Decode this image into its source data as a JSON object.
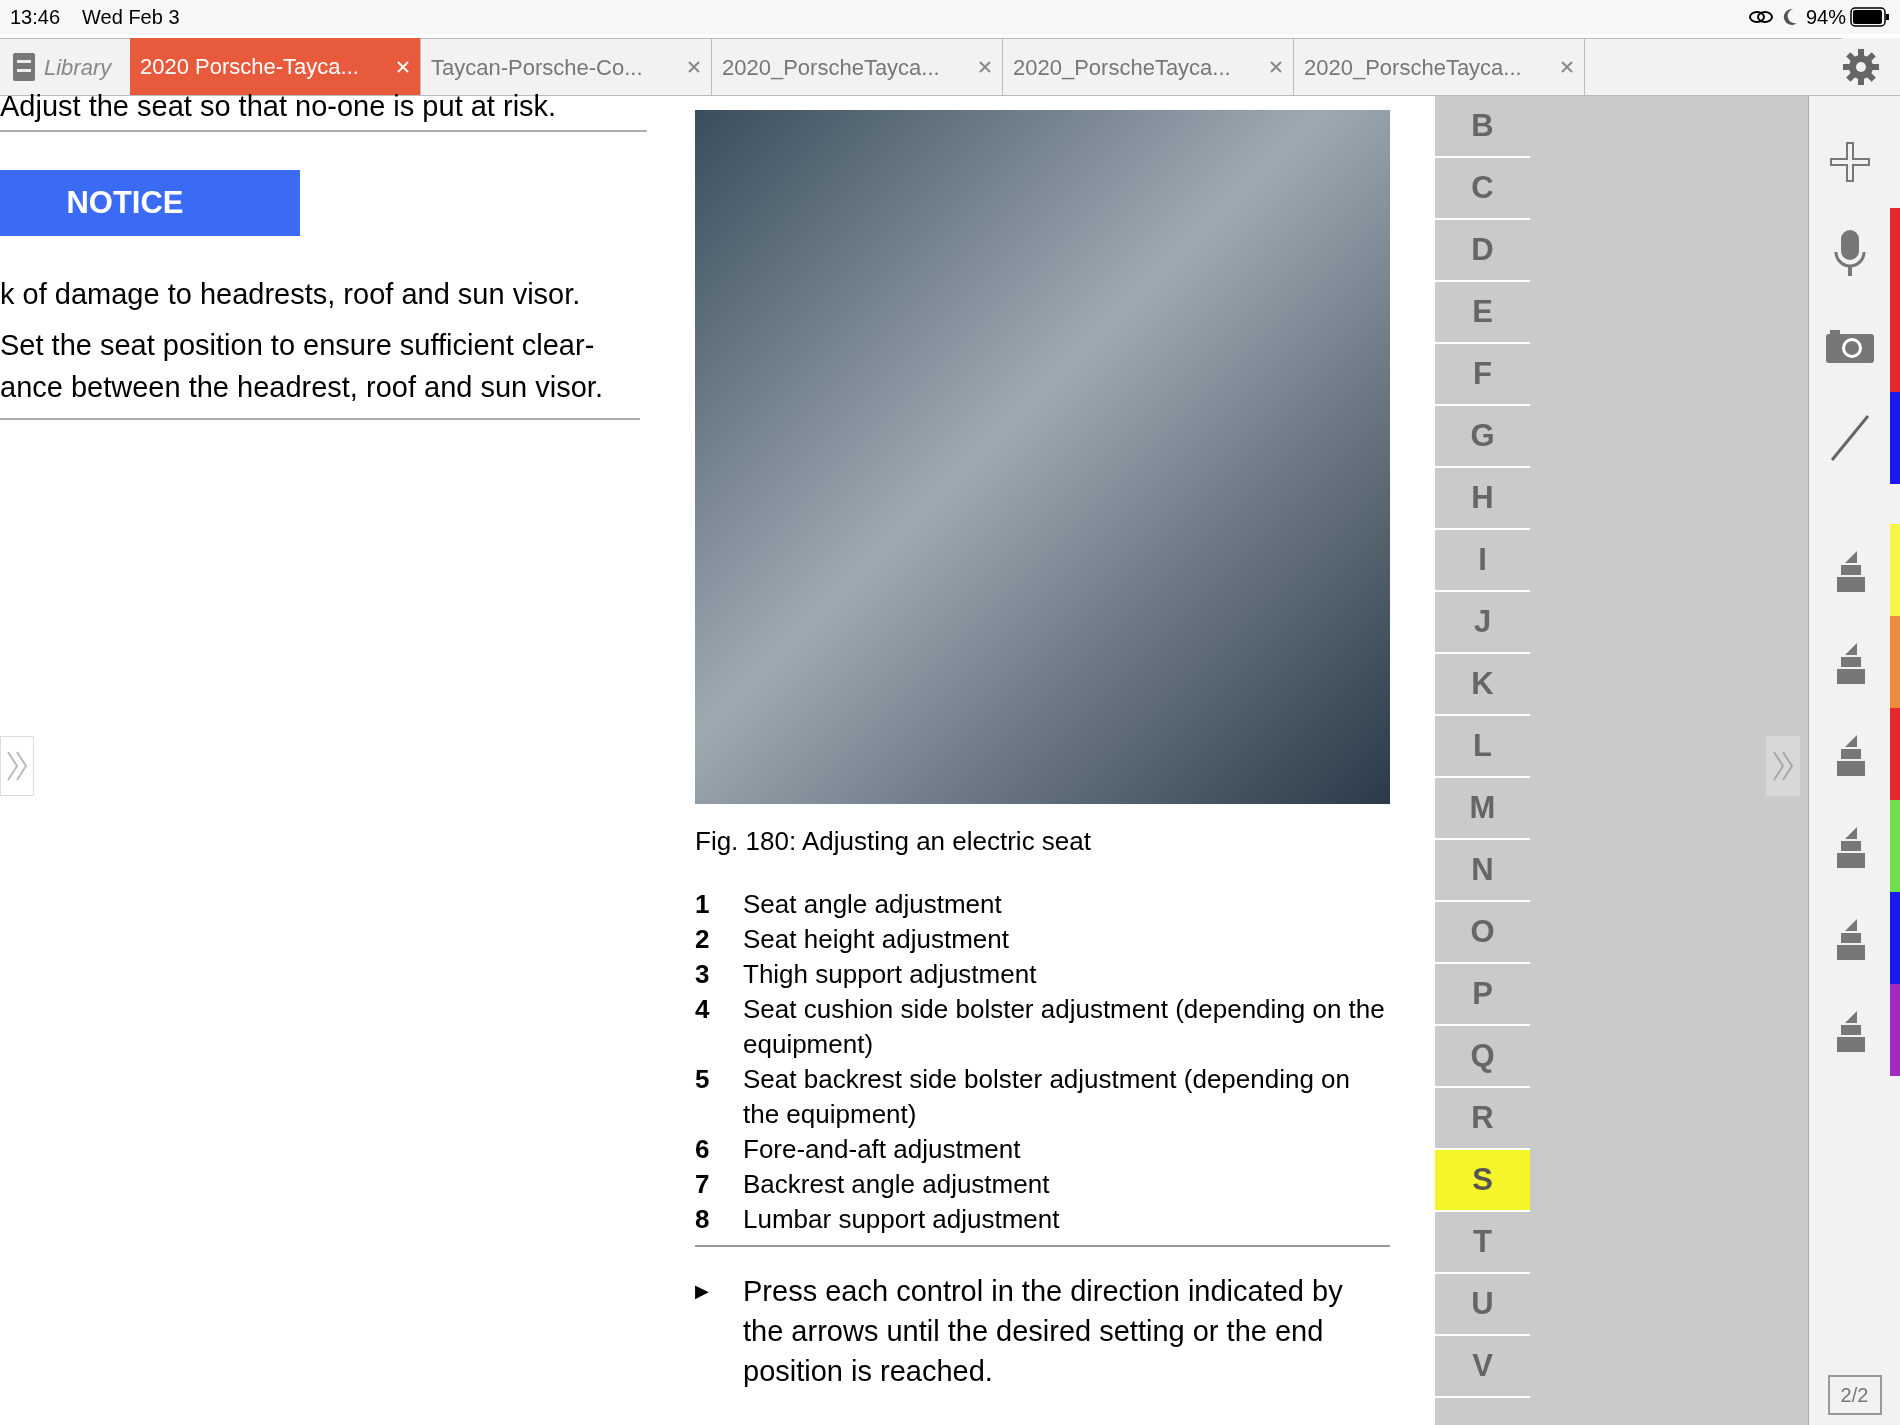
{
  "status_bar": {
    "time": "13:46",
    "date": "Wed Feb 3",
    "battery": "94%"
  },
  "library_button": {
    "label": "Library"
  },
  "tabs": [
    {
      "label": "2020 Porsche-Tayca...",
      "selected": true
    },
    {
      "label": "Taycan-Porsche-Co...",
      "selected": false
    },
    {
      "label": "2020_PorscheTayca...",
      "selected": false
    },
    {
      "label": "2020_PorscheTayca...",
      "selected": false
    },
    {
      "label": "2020_PorscheTayca...",
      "selected": false
    }
  ],
  "left_column": {
    "warning_text": "Adjust the seat so that no-one is put at risk.",
    "notice_label": "NOTICE",
    "risk_text": "k of damage to headrests, roof and sun visor.",
    "instruction_text": "Set the seat position to ensure sufficient clear-ance between the headrest, roof and sun visor."
  },
  "figure": {
    "caption": "Fig. 180: Adjusting an electric seat"
  },
  "legend": [
    {
      "number": "1",
      "text": "Seat angle adjustment"
    },
    {
      "number": "2",
      "text": "Seat height adjustment"
    },
    {
      "number": "3",
      "text": "Thigh support adjustment"
    },
    {
      "number": "4",
      "text": "Seat cushion side bolster adjustment (depending on the equipment)"
    },
    {
      "number": "5",
      "text": "Seat backrest side bolster adjustment (depending on the equipment)"
    },
    {
      "number": "6",
      "text": "Fore-and-aft adjustment"
    },
    {
      "number": "7",
      "text": "Backrest angle adjustment"
    },
    {
      "number": "8",
      "text": "Lumbar support adjustment"
    }
  ],
  "step": {
    "bullet": "▶",
    "text": "Press each control in the direction indicated by the arrows until the desired setting or the end position is reached."
  },
  "index": [
    {
      "letter": "B",
      "selected": false
    },
    {
      "letter": "C",
      "selected": false
    },
    {
      "letter": "D",
      "selected": false
    },
    {
      "letter": "E",
      "selected": false
    },
    {
      "letter": "F",
      "selected": false
    },
    {
      "letter": "G",
      "selected": false
    },
    {
      "letter": "H",
      "selected": false
    },
    {
      "letter": "I",
      "selected": false
    },
    {
      "letter": "J",
      "selected": false
    },
    {
      "letter": "K",
      "selected": false
    },
    {
      "letter": "L",
      "selected": false
    },
    {
      "letter": "M",
      "selected": false
    },
    {
      "letter": "N",
      "selected": false
    },
    {
      "letter": "O",
      "selected": false
    },
    {
      "letter": "P",
      "selected": false
    },
    {
      "letter": "Q",
      "selected": false
    },
    {
      "letter": "R",
      "selected": false
    },
    {
      "letter": "S",
      "selected": true
    },
    {
      "letter": "T",
      "selected": false
    },
    {
      "letter": "U",
      "selected": false
    },
    {
      "letter": "V",
      "selected": false
    }
  ],
  "tools": [
    {
      "kind": "plus"
    },
    {
      "kind": "mic",
      "color": "#e8262b"
    },
    {
      "kind": "camera",
      "color": "#e8262b"
    },
    {
      "kind": "pen",
      "color": "#1a1af0"
    },
    {
      "kind": "highlighter",
      "color": "#f7f545"
    },
    {
      "kind": "highlighter",
      "color": "#ee8a3a"
    },
    {
      "kind": "highlighter",
      "color": "#e8262b"
    },
    {
      "kind": "highlighter",
      "color": "#6ee04a"
    },
    {
      "kind": "highlighter",
      "color": "#1a1af0"
    },
    {
      "kind": "highlighter",
      "color": "#a428c4"
    }
  ],
  "page_indicator": "2/2"
}
